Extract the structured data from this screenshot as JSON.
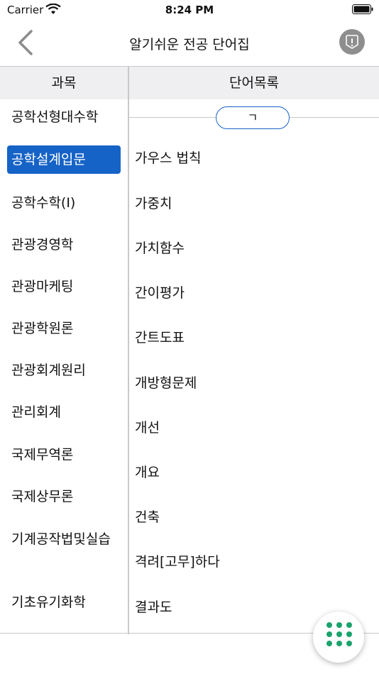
{
  "status_bar": {
    "carrier": "Carrier",
    "time": "8:24 PM"
  },
  "nav": {
    "title": "알기쉬운 전공 단어집"
  },
  "columns": {
    "left_header": "과목",
    "right_header": "단어목록"
  },
  "subjects": [
    {
      "label": "공학선형대수학"
    },
    {
      "label": "공학설계입문"
    },
    {
      "label": "공학수학(Ⅰ)"
    },
    {
      "label": "관광경영학"
    },
    {
      "label": "관광마케팅"
    },
    {
      "label": "관광학원론"
    },
    {
      "label": "관광회계원리"
    },
    {
      "label": "관리회계"
    },
    {
      "label": "국제무역론"
    },
    {
      "label": "국제상무론"
    },
    {
      "label": "기계공작법및실습"
    },
    {
      "label": "기초유기화학"
    }
  ],
  "selected_subject": "공학설계입문",
  "index_label": "ㄱ",
  "words": [
    {
      "label": "가우스 법칙"
    },
    {
      "label": "가중치"
    },
    {
      "label": "가치함수"
    },
    {
      "label": "간이평가"
    },
    {
      "label": "간트도표"
    },
    {
      "label": "개방형문제"
    },
    {
      "label": "개선"
    },
    {
      "label": "개요"
    },
    {
      "label": "건축"
    },
    {
      "label": "격려[고무]하다"
    },
    {
      "label": "결과도"
    }
  ],
  "icons": {
    "back": "chevron-left-icon",
    "report": "exclamation-badge-icon",
    "fab": "grid-dots-icon",
    "accent_color": "#1663c7",
    "fab_color": "#1aa36b"
  }
}
